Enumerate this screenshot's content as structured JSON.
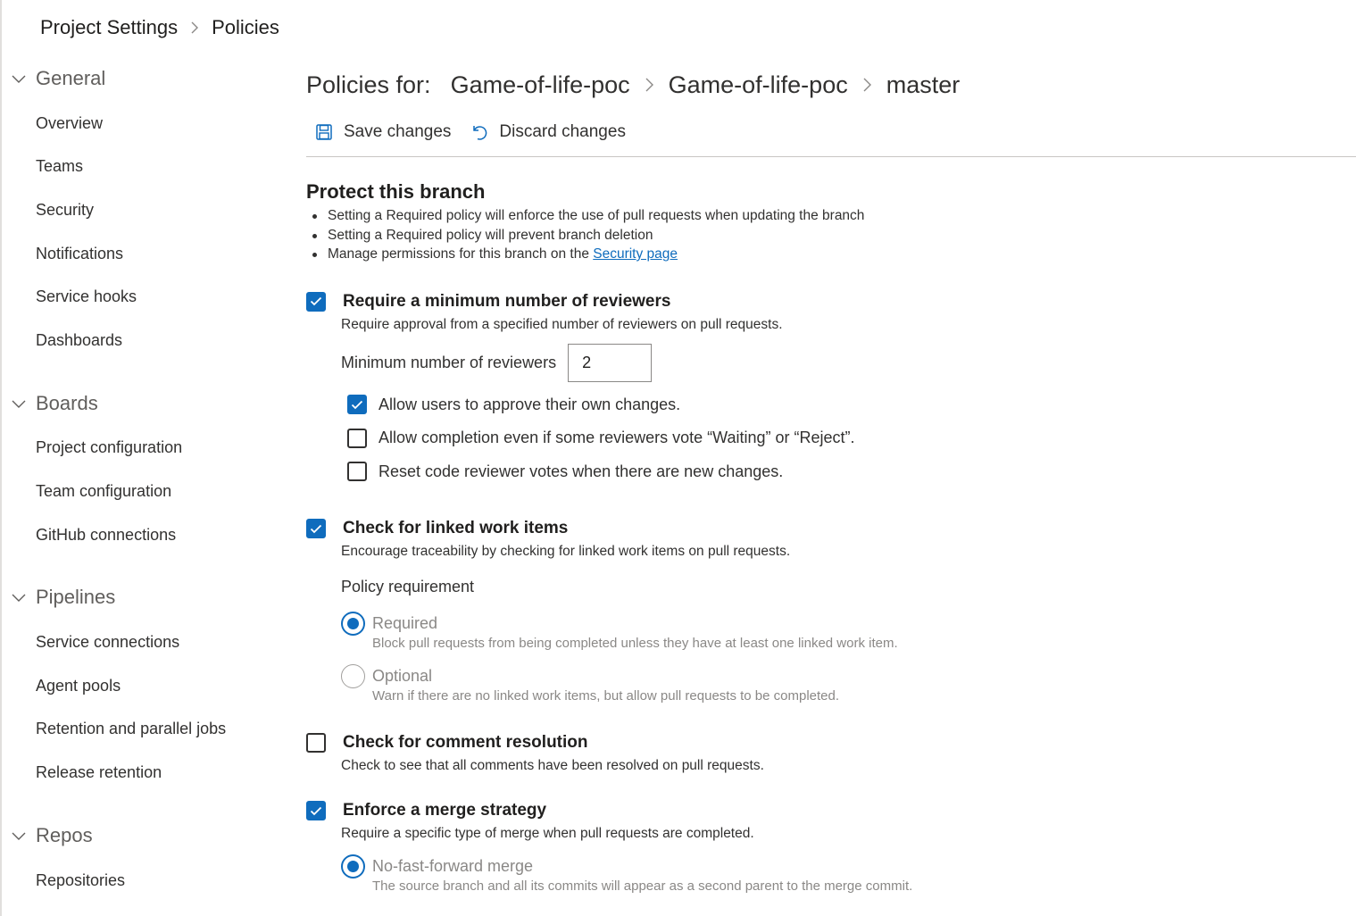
{
  "breadcrumb": {
    "root": "Project Settings",
    "current": "Policies"
  },
  "sidebar": {
    "groups": [
      {
        "label": "General",
        "items": [
          "Overview",
          "Teams",
          "Security",
          "Notifications",
          "Service hooks",
          "Dashboards"
        ]
      },
      {
        "label": "Boards",
        "items": [
          "Project configuration",
          "Team configuration",
          "GitHub connections"
        ]
      },
      {
        "label": "Pipelines",
        "items": [
          "Service connections",
          "Agent pools",
          "Retention and parallel jobs",
          "Release retention"
        ]
      },
      {
        "label": "Repos",
        "items": [
          "Repositories"
        ]
      }
    ]
  },
  "header": {
    "lead": "Policies for:",
    "project": "Game-of-life-poc",
    "repo": "Game-of-life-poc",
    "branch": "master"
  },
  "toolbar": {
    "save_label": "Save changes",
    "discard_label": "Discard changes"
  },
  "protect": {
    "title": "Protect this branch",
    "bullet1": "Setting a Required policy will enforce the use of pull requests when updating the branch",
    "bullet2": "Setting a Required policy will prevent branch deletion",
    "bullet3_prefix": "Manage permissions for this branch on the ",
    "bullet3_link": "Security page"
  },
  "reviewers": {
    "checked": true,
    "title": "Require a minimum number of reviewers",
    "description": "Require approval from a specified number of reviewers on pull requests.",
    "min_label": "Minimum number of reviewers",
    "min_value": "2",
    "options": [
      {
        "label": "Allow users to approve their own changes.",
        "checked": true
      },
      {
        "label": "Allow completion even if some reviewers vote “Waiting” or “Reject”.",
        "checked": false
      },
      {
        "label": "Reset code reviewer votes when there are new changes.",
        "checked": false
      }
    ]
  },
  "work_items": {
    "checked": true,
    "title": "Check for linked work items",
    "description": "Encourage traceability by checking for linked work items on pull requests.",
    "requirement_label": "Policy requirement",
    "required_label": "Required",
    "required_help": "Block pull requests from being completed unless they have at least one linked work item.",
    "optional_label": "Optional",
    "optional_help": "Warn if there are no linked work items, but allow pull requests to be completed.",
    "selected": "Required"
  },
  "comments": {
    "checked": false,
    "title": "Check for comment resolution",
    "description": "Check to see that all comments have been resolved on pull requests."
  },
  "merge": {
    "checked": true,
    "title": "Enforce a merge strategy",
    "description": "Require a specific type of merge when pull requests are completed.",
    "option_label": "No-fast-forward merge",
    "option_help": "The source branch and all its commits will appear as a second parent to the merge commit.",
    "selected": "No-fast-forward merge"
  },
  "colors": {
    "accent": "#0f6cbd",
    "text": "#201f1e",
    "muted": "#8a8886"
  }
}
